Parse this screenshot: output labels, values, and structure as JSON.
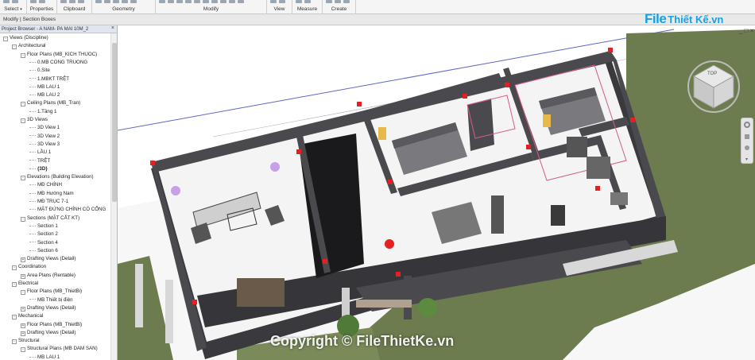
{
  "ribbon": {
    "groups": [
      {
        "label": "Select",
        "dropdown": true,
        "w": 34
      },
      {
        "label": "Properties",
        "dropdown": false,
        "w": 38
      },
      {
        "label": "Clipboard",
        "dropdown": false,
        "w": 44
      },
      {
        "label": "Geometry",
        "dropdown": false,
        "w": 80
      },
      {
        "label": "Modify",
        "dropdown": false,
        "w": 140
      },
      {
        "label": "View",
        "dropdown": false,
        "w": 32
      },
      {
        "label": "Measure",
        "dropdown": false,
        "w": 38
      },
      {
        "label": "Create",
        "dropdown": false,
        "w": 42
      }
    ]
  },
  "options_bar": {
    "text": "Modify | Section Boxes"
  },
  "browser": {
    "title": "Project Browser - A NAM- PA MAI 10M_2",
    "close": "×",
    "tree": [
      {
        "d": 0,
        "t": "-",
        "label": "Views (Discipline)"
      },
      {
        "d": 1,
        "t": "-",
        "label": "Architectural"
      },
      {
        "d": 2,
        "t": "-",
        "label": "Floor Plans (MB_KICH THUOC)"
      },
      {
        "d": 3,
        "t": "",
        "label": "0.MB CONG TRUONG"
      },
      {
        "d": 3,
        "t": "",
        "label": "0.Site"
      },
      {
        "d": 3,
        "t": "",
        "label": "1.MBKT TRỆT"
      },
      {
        "d": 3,
        "t": "",
        "label": "MB LAU 1"
      },
      {
        "d": 3,
        "t": "",
        "label": "MB LAU 2"
      },
      {
        "d": 2,
        "t": "-",
        "label": "Ceiling Plans (MB_Tran)"
      },
      {
        "d": 3,
        "t": "",
        "label": "1.Tầng 1"
      },
      {
        "d": 2,
        "t": "-",
        "label": "3D Views"
      },
      {
        "d": 3,
        "t": "",
        "label": "3D View 1"
      },
      {
        "d": 3,
        "t": "",
        "label": "3D View 2"
      },
      {
        "d": 3,
        "t": "",
        "label": "3D View 3"
      },
      {
        "d": 3,
        "t": "",
        "label": "LẦU 1"
      },
      {
        "d": 3,
        "t": "",
        "label": "TRỆT"
      },
      {
        "d": 3,
        "t": "",
        "label": "{3D}",
        "bold": true
      },
      {
        "d": 2,
        "t": "-",
        "label": "Elevations (Building Elevation)"
      },
      {
        "d": 3,
        "t": "",
        "label": "MĐ CHÍNH"
      },
      {
        "d": 3,
        "t": "",
        "label": "MĐ Hướng Nam"
      },
      {
        "d": 3,
        "t": "",
        "label": "MĐ TRỤC 7-1"
      },
      {
        "d": 3,
        "t": "",
        "label": "MẶT ĐỨNG CHÍNH CÓ CỔNG"
      },
      {
        "d": 2,
        "t": "-",
        "label": "Sections (MẶT CẮT KT)"
      },
      {
        "d": 3,
        "t": "",
        "label": "Section 1"
      },
      {
        "d": 3,
        "t": "",
        "label": "Section 2"
      },
      {
        "d": 3,
        "t": "",
        "label": "Section 4"
      },
      {
        "d": 3,
        "t": "",
        "label": "Section 6"
      },
      {
        "d": 2,
        "t": "+",
        "label": "Drafting Views (Detail)"
      },
      {
        "d": 1,
        "t": "-",
        "label": "Coordination"
      },
      {
        "d": 2,
        "t": "+",
        "label": "Area Plans (Rentable)"
      },
      {
        "d": 1,
        "t": "-",
        "label": "Electrical"
      },
      {
        "d": 2,
        "t": "-",
        "label": "Floor Plans (MB_ThietBi)"
      },
      {
        "d": 3,
        "t": "",
        "label": "MB Thiết bị điện"
      },
      {
        "d": 2,
        "t": "+",
        "label": "Drafting Views (Detail)"
      },
      {
        "d": 1,
        "t": "-",
        "label": "Mechanical"
      },
      {
        "d": 2,
        "t": "+",
        "label": "Floor Plans (MB_ThietBi)"
      },
      {
        "d": 2,
        "t": "+",
        "label": "Drafting Views (Detail)"
      },
      {
        "d": 1,
        "t": "-",
        "label": "Structural"
      },
      {
        "d": 2,
        "t": "-",
        "label": "Structural Plans (MB DAM SAN)"
      },
      {
        "d": 3,
        "t": "",
        "label": "MB LAU 1"
      }
    ]
  },
  "viewport": {
    "viewcube_face": "TOP",
    "viewport_controls": "_ □ ×"
  },
  "watermark": {
    "logo_fi": "File",
    "logo_rest": "Thiết Kế.vn",
    "copyright": "Copyright © FileThietKe.vn"
  },
  "colors": {
    "accent": "#1a9fe0",
    "wall_top": "#4a4a4e",
    "wall_side": "#35353a",
    "grass": "#6d7c4e",
    "marker": "#e52020"
  }
}
